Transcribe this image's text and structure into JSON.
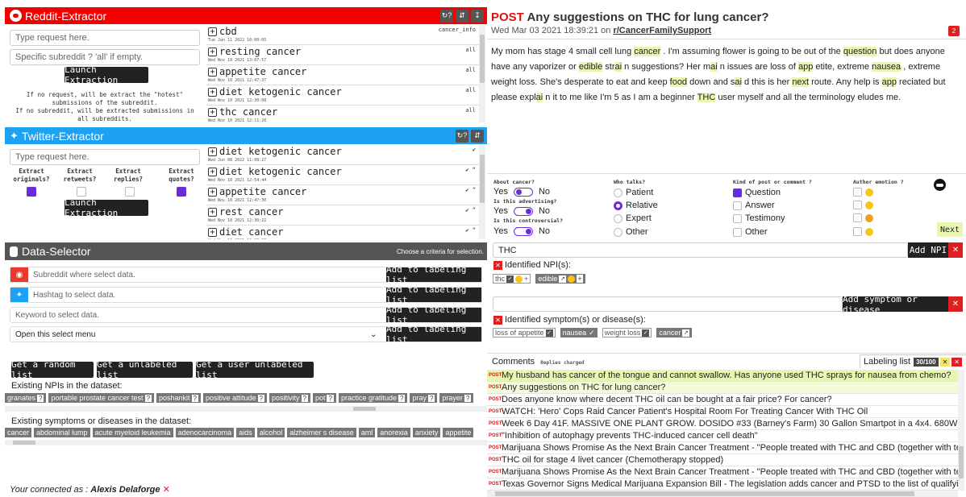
{
  "reddit": {
    "title": "Reddit-Extractor",
    "request_ph": "Type request here.",
    "subreddit_ph": "Specific subreddit ? 'all' if empty.",
    "launch": "Launch Extraction",
    "note1": "If no request, will be extract the \"hotest\" submissions of the subreddit.",
    "note2": "If no subreddit, will be extracted submissions in all subreddits.",
    "btn1": "↻?",
    "btn2": "⇵",
    "btn3": "↧",
    "items": [
      {
        "t": "cbd",
        "d": "Tue Jan 11 2022 10:00:05",
        "s": "cancer_info"
      },
      {
        "t": "resting cancer",
        "d": "Wed Nov 10 2021 13:07:57",
        "s": "all"
      },
      {
        "t": "appetite cancer",
        "d": "Wed Nov 10 2021 12:47:37",
        "s": "all"
      },
      {
        "t": "diet ketogenic cancer",
        "d": "Wed Nov 10 2021 12:30:08",
        "s": "all"
      },
      {
        "t": "thc cancer",
        "d": "Wed Nov 10 2021 12:11:20",
        "s": "all"
      }
    ]
  },
  "twitter": {
    "title": "Twitter-Extractor",
    "request_ph": "Type request here.",
    "col1": "Extract originals?",
    "col2": "Extract retweets?",
    "col3": "Extract replies?",
    "col4": "Extract quotes?",
    "launch": "Launch Extraction",
    "btn1": "↻?",
    "btn2": "⇵",
    "items": [
      {
        "t": "diet ketogenic cancer",
        "d": "Wed Jun 08 2022 11:08:27",
        "s": "✔"
      },
      {
        "t": "diet ketogenic cancer",
        "d": "Wed Nov 10 2021 12:54:44",
        "s": "✔ “"
      },
      {
        "t": "appetite cancer",
        "d": "Wed Nov 10 2021 12:47:30",
        "s": "✔ “"
      },
      {
        "t": "rest cancer",
        "d": "Wed Nov 10 2021 12:30:22",
        "s": "✔ “"
      },
      {
        "t": "diet cancer",
        "d": "Wed Nov 10 2021 12:00:00",
        "s": "✔ “"
      }
    ]
  },
  "selector": {
    "title": "Data-Selector",
    "hint": "Choose a criteria for selection.",
    "sub_ph": "Subreddit where select data.",
    "hash_ph": "Hashtag to select data.",
    "kw_ph": "Keyword to select data.",
    "menu": "Open this select menu",
    "add": "Add to labeling list",
    "random": "Get a random list",
    "unlabeled": "Get a unlabeled list",
    "user_unlabeled": "Get a user unlabeled list",
    "npis_title": "Existing NPIs in the dataset:",
    "symptoms_title": "Existing symptoms or diseases in the dataset:",
    "npis": [
      "granates",
      "portable prostate cancer test",
      "poshankit",
      "positive attitude",
      "positivity",
      "pot",
      "practice gratitude",
      "pray",
      "prayer"
    ],
    "symptoms": [
      "cancer",
      "abdominal lump",
      "acute myeloid leukemia",
      "adenocarcinoma",
      "aids",
      "alcohol",
      "alzheimer s disease",
      "aml",
      "anorexia",
      "anxiety",
      "appetite"
    ]
  },
  "footer": {
    "prefix": "Your connected as : ",
    "user": "Alexis Delaforge",
    "x": "✕"
  },
  "post": {
    "label": "POST",
    "title": "Any suggestions on THC for lung cancer?",
    "date": "Wed Mar 03 2021 18:39:21 on ",
    "sub": "r/CancerFamilySupport",
    "badge": "2"
  },
  "labels": {
    "about": "About cancer?",
    "yes": "Yes",
    "no": "No",
    "adv": "Is this advertising?",
    "contro": "Is this controversial?",
    "who": "Who talks?",
    "patient": "Patient",
    "relative": "Relative",
    "expert": "Expert",
    "other": "Other",
    "kind": "Kind of post or comment ?",
    "question": "Question",
    "answer": "Answer",
    "testimony": "Testimony",
    "other2": "Other",
    "emotion": "Author emotion ?",
    "next": "Next"
  },
  "npi": {
    "input": "THC",
    "add": "Add NPI",
    "title": "Identified NPI(s):",
    "chips": [
      "thc",
      "edible"
    ]
  },
  "symptom": {
    "add": "Add symptom or disease",
    "title": "Identified symptom(s) or disease(s):",
    "chips": [
      "loss of appetite",
      "nausea",
      "weight loss",
      "cancer"
    ]
  },
  "comments": {
    "title": "Comments",
    "sub": "Replies charged",
    "labeling": "Labeling list",
    "count": "30/100",
    "rows": [
      "My husband has cancer of the tongue and cannot swallow. Has anyone used THC sprays for nausea from chemo?",
      "Any suggestions on THC for lung cancer?",
      "Does anyone know where decent THC oil can be bought at a fair price? For cancer?",
      "WATCH: 'Hero' Cops Raid Cancer Patient's Hospital Room For Treating Cancer With THC Oil",
      "Week 6 Day 41F. MASSIVE ONE PLANT GROW. DOSIDO #33 (Barney's Farm) 30 Gallon Smartpot in a 4x4. 680W LED + 64w",
      "\"Inhibition of autophagy prevents THC-induced cancer cell death\"",
      "Marijuana Shows Promise As the Next Brain Cancer Treatment - \"People treated with THC and CBD (together with temoz",
      "THC oil for stage 4 livet cancer (Chemotherapy stopped)",
      "Marijuana Shows Promise As the Next Brain Cancer Treatment - \"People treated with THC and CBD (together with temoz",
      "Texas Governor Signs Medical Marijuana Expansion Bill - The legislation adds cancer and PTSD to the list of qualifying"
    ]
  },
  "colors": {
    "reddit": "#ff0000",
    "twitter": "#1da1f2",
    "selector": "#555555",
    "highlight": "#e7f7b0",
    "accent": "#6a2bd9"
  }
}
